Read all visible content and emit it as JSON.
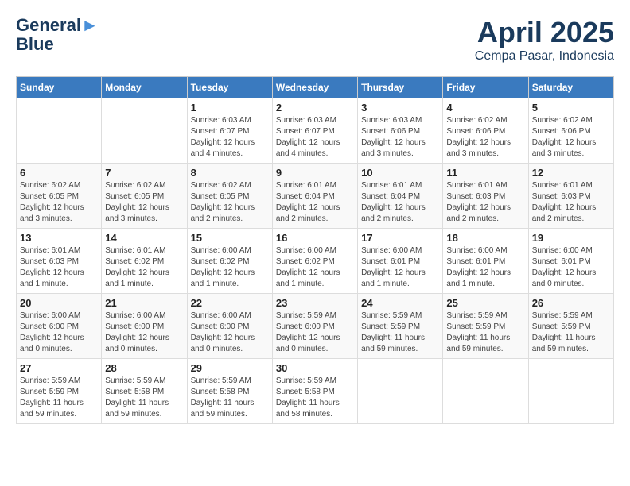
{
  "header": {
    "logo_line1": "General",
    "logo_line2": "Blue",
    "title": "April 2025",
    "subtitle": "Cempa Pasar, Indonesia"
  },
  "days_of_week": [
    "Sunday",
    "Monday",
    "Tuesday",
    "Wednesday",
    "Thursday",
    "Friday",
    "Saturday"
  ],
  "weeks": [
    [
      {
        "day": "",
        "info": ""
      },
      {
        "day": "",
        "info": ""
      },
      {
        "day": "1",
        "info": "Sunrise: 6:03 AM\nSunset: 6:07 PM\nDaylight: 12 hours\nand 4 minutes."
      },
      {
        "day": "2",
        "info": "Sunrise: 6:03 AM\nSunset: 6:07 PM\nDaylight: 12 hours\nand 4 minutes."
      },
      {
        "day": "3",
        "info": "Sunrise: 6:03 AM\nSunset: 6:06 PM\nDaylight: 12 hours\nand 3 minutes."
      },
      {
        "day": "4",
        "info": "Sunrise: 6:02 AM\nSunset: 6:06 PM\nDaylight: 12 hours\nand 3 minutes."
      },
      {
        "day": "5",
        "info": "Sunrise: 6:02 AM\nSunset: 6:06 PM\nDaylight: 12 hours\nand 3 minutes."
      }
    ],
    [
      {
        "day": "6",
        "info": "Sunrise: 6:02 AM\nSunset: 6:05 PM\nDaylight: 12 hours\nand 3 minutes."
      },
      {
        "day": "7",
        "info": "Sunrise: 6:02 AM\nSunset: 6:05 PM\nDaylight: 12 hours\nand 3 minutes."
      },
      {
        "day": "8",
        "info": "Sunrise: 6:02 AM\nSunset: 6:05 PM\nDaylight: 12 hours\nand 2 minutes."
      },
      {
        "day": "9",
        "info": "Sunrise: 6:01 AM\nSunset: 6:04 PM\nDaylight: 12 hours\nand 2 minutes."
      },
      {
        "day": "10",
        "info": "Sunrise: 6:01 AM\nSunset: 6:04 PM\nDaylight: 12 hours\nand 2 minutes."
      },
      {
        "day": "11",
        "info": "Sunrise: 6:01 AM\nSunset: 6:03 PM\nDaylight: 12 hours\nand 2 minutes."
      },
      {
        "day": "12",
        "info": "Sunrise: 6:01 AM\nSunset: 6:03 PM\nDaylight: 12 hours\nand 2 minutes."
      }
    ],
    [
      {
        "day": "13",
        "info": "Sunrise: 6:01 AM\nSunset: 6:03 PM\nDaylight: 12 hours\nand 1 minute."
      },
      {
        "day": "14",
        "info": "Sunrise: 6:01 AM\nSunset: 6:02 PM\nDaylight: 12 hours\nand 1 minute."
      },
      {
        "day": "15",
        "info": "Sunrise: 6:00 AM\nSunset: 6:02 PM\nDaylight: 12 hours\nand 1 minute."
      },
      {
        "day": "16",
        "info": "Sunrise: 6:00 AM\nSunset: 6:02 PM\nDaylight: 12 hours\nand 1 minute."
      },
      {
        "day": "17",
        "info": "Sunrise: 6:00 AM\nSunset: 6:01 PM\nDaylight: 12 hours\nand 1 minute."
      },
      {
        "day": "18",
        "info": "Sunrise: 6:00 AM\nSunset: 6:01 PM\nDaylight: 12 hours\nand 1 minute."
      },
      {
        "day": "19",
        "info": "Sunrise: 6:00 AM\nSunset: 6:01 PM\nDaylight: 12 hours\nand 0 minutes."
      }
    ],
    [
      {
        "day": "20",
        "info": "Sunrise: 6:00 AM\nSunset: 6:00 PM\nDaylight: 12 hours\nand 0 minutes."
      },
      {
        "day": "21",
        "info": "Sunrise: 6:00 AM\nSunset: 6:00 PM\nDaylight: 12 hours\nand 0 minutes."
      },
      {
        "day": "22",
        "info": "Sunrise: 6:00 AM\nSunset: 6:00 PM\nDaylight: 12 hours\nand 0 minutes."
      },
      {
        "day": "23",
        "info": "Sunrise: 5:59 AM\nSunset: 6:00 PM\nDaylight: 12 hours\nand 0 minutes."
      },
      {
        "day": "24",
        "info": "Sunrise: 5:59 AM\nSunset: 5:59 PM\nDaylight: 11 hours\nand 59 minutes."
      },
      {
        "day": "25",
        "info": "Sunrise: 5:59 AM\nSunset: 5:59 PM\nDaylight: 11 hours\nand 59 minutes."
      },
      {
        "day": "26",
        "info": "Sunrise: 5:59 AM\nSunset: 5:59 PM\nDaylight: 11 hours\nand 59 minutes."
      }
    ],
    [
      {
        "day": "27",
        "info": "Sunrise: 5:59 AM\nSunset: 5:59 PM\nDaylight: 11 hours\nand 59 minutes."
      },
      {
        "day": "28",
        "info": "Sunrise: 5:59 AM\nSunset: 5:58 PM\nDaylight: 11 hours\nand 59 minutes."
      },
      {
        "day": "29",
        "info": "Sunrise: 5:59 AM\nSunset: 5:58 PM\nDaylight: 11 hours\nand 59 minutes."
      },
      {
        "day": "30",
        "info": "Sunrise: 5:59 AM\nSunset: 5:58 PM\nDaylight: 11 hours\nand 58 minutes."
      },
      {
        "day": "",
        "info": ""
      },
      {
        "day": "",
        "info": ""
      },
      {
        "day": "",
        "info": ""
      }
    ]
  ]
}
